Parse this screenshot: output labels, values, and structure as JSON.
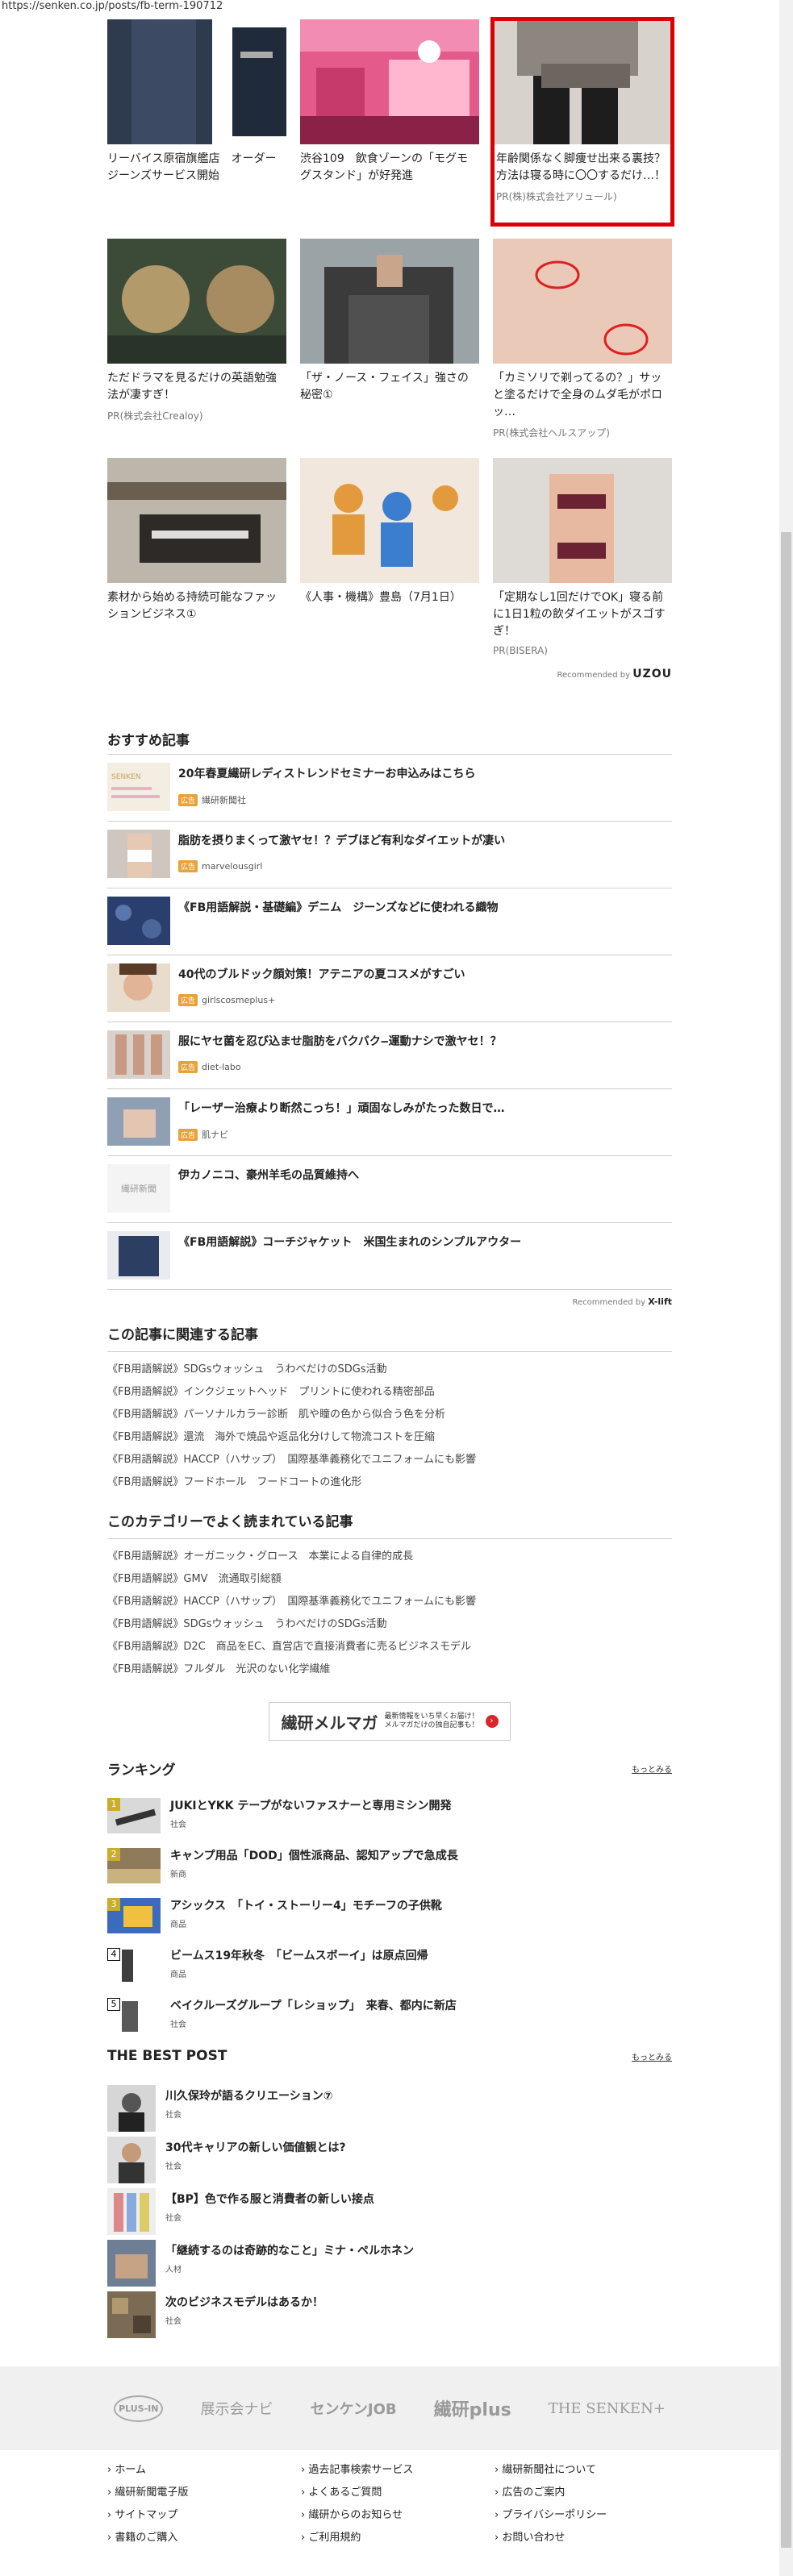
{
  "url": "https://senken.co.jp/posts/fb-term-190712",
  "pr_cards": [
    {
      "title": "リーバイス原宿旗艦店　オーダージーンズサービス開始",
      "source": ""
    },
    {
      "title": "渋谷109　飲食ゾーンの「モグモグスタンド」が好発進",
      "source": ""
    },
    {
      "title": "年齢関係なく脚痩せ出来る裏技？方法は寝る時に〇〇するだけ…！",
      "source": "PR(株)株式会社アリュール)"
    },
    {
      "title": "ただドラマを見るだけの英語勉強法が凄すぎ！",
      "source": "PR(株式会社Crealoy)"
    },
    {
      "title": "「ザ・ノース・フェイス」強さの秘密①",
      "source": ""
    },
    {
      "title": "「カミソリで剃ってるの？」サッと塗るだけで全身のムダ毛がポロッ…",
      "source": "PR(株式会社ヘルスアップ)"
    },
    {
      "title": "素材から始める持続可能なファッションビジネス①",
      "source": ""
    },
    {
      "title": "《人事・機構》豊島（7月1日）",
      "source": ""
    },
    {
      "title": "「定期なし1回だけでOK」寝る前に1日1粒の飲ダイエットがスゴすぎ！",
      "source": "PR(BISERA)"
    }
  ],
  "recommended_by": "Recommended by",
  "uzou": "UZOU",
  "reco": {
    "heading": "おすすめ記事",
    "items": [
      {
        "title": "20年春夏繊研レディストレンドセミナーお申込みはこちら",
        "badge": "広告",
        "source": "繊研新聞社"
      },
      {
        "title": "脂肪を摂りまくって激ヤセ！？デブほど有利なダイエットが凄い",
        "badge": "広告",
        "source": "marvelousgirl"
      },
      {
        "title": "《FB用語解説・基礎編》デニム　ジーンズなどに使われる織物",
        "badge": "",
        "source": ""
      },
      {
        "title": "40代のブルドック顔対策！アテニアの夏コスメがすごい",
        "badge": "広告",
        "source": "girlscosmeplus+"
      },
      {
        "title": "服にヤセ菌を忍び込ませ脂肪をバクバク‒運動ナシで激ヤセ！？",
        "badge": "広告",
        "source": "diet-labo"
      },
      {
        "title": "「レーザー治療より断然こっち！」頑固なしみがたった数日で…",
        "badge": "広告",
        "source": "肌ナビ"
      },
      {
        "title": "伊カノニコ、豪州羊毛の品質維持へ",
        "badge": "",
        "source": ""
      },
      {
        "title": "《FB用語解説》コーチジャケット　米国生まれのシンプルアウター",
        "badge": "",
        "source": ""
      }
    ],
    "powered": "Recommended by",
    "xlift": "X-lift",
    "thumb_text": "繊研新聞"
  },
  "related": {
    "heading": "この記事に関連する記事",
    "items": [
      "《FB用語解説》SDGsウォッシュ　うわべだけのSDGs活動",
      "《FB用語解説》インクジェットヘッド　プリントに使われる精密部品",
      "《FB用語解説》パーソナルカラー診断　肌や瞳の色から似合う色を分析",
      "《FB用語解説》還流　海外で焼品や返品化分けして物流コストを圧縮",
      "《FB用語解説》HACCP（ハサップ）　国際基準義務化でユニフォームにも影響",
      "《FB用語解説》フードホール　フードコートの進化形"
    ]
  },
  "category": {
    "heading": "このカテゴリーでよく読まれている記事",
    "items": [
      "《FB用語解説》オーガニック・グロース　本業による自律的成長",
      "《FB用語解説》GMV　流通取引総額",
      "《FB用語解説》HACCP（ハサップ）　国際基準義務化でユニフォームにも影響",
      "《FB用語解説》SDGsウォッシュ　うわべだけのSDGs活動",
      "《FB用語解説》D2C　商品をEC、直営店で直接消費者に売るビジネスモデル",
      "《FB用語解説》フルダル　光沢のない化学繊維"
    ]
  },
  "mail": {
    "title": "繊研メルマガ",
    "sub1": "最新情報をいち早くお届け！",
    "sub2": "メルマガだけの独自記事も！",
    "dot": "›"
  },
  "ranking": {
    "heading": "ランキング",
    "more": "もっとみる",
    "items": [
      {
        "num": "1",
        "title": "JUKIとYKK テープがないファスナーと専用ミシン開発",
        "cat": "社会"
      },
      {
        "num": "2",
        "title": "キャンプ用品「DOD」個性派商品、認知アップで急成長",
        "cat": "新商"
      },
      {
        "num": "3",
        "title": "アシックス　「トイ・ストーリー4」モチーフの子供靴",
        "cat": "商品"
      },
      {
        "num": "4",
        "title": "ビームス19年秋冬　「ビームスボーイ」は原点回帰",
        "cat": "商品"
      },
      {
        "num": "5",
        "title": "ベイクルーズグループ「レショップ」　来春、都内に新店",
        "cat": "社会"
      }
    ]
  },
  "best": {
    "heading": "THE BEST POST",
    "more": "もっとみる",
    "items": [
      {
        "title": "川久保玲が語るクリエーション⑦",
        "cat": "社会"
      },
      {
        "title": "30代キャリアの新しい価値観とは?",
        "cat": "社会"
      },
      {
        "title": "【BP】色で作る服と消費者の新しい接点",
        "cat": "社会"
      },
      {
        "title": "「継続するのは奇跡的なこと」ミナ・ペルホネン",
        "cat": "人材"
      },
      {
        "title": "次のビジネスモデルはあるか！",
        "cat": "社会"
      }
    ]
  },
  "footer_logos": [
    "PLUS-IN",
    "展示会ナビ",
    "センケンJOB",
    "繊研plus",
    "THE SENKEN+"
  ],
  "footer_links": [
    "› ホーム",
    "› 過去記事検索サービス",
    "› 繊研新聞社について",
    "› 繊研新聞電子版",
    "› よくあるご質問",
    "› 広告のご案内",
    "› サイトマップ",
    "› 繊研からのお知らせ",
    "› プライバシーポリシー",
    "› 書籍のご購入",
    "› ご利用規約",
    "› お問い合わせ"
  ]
}
